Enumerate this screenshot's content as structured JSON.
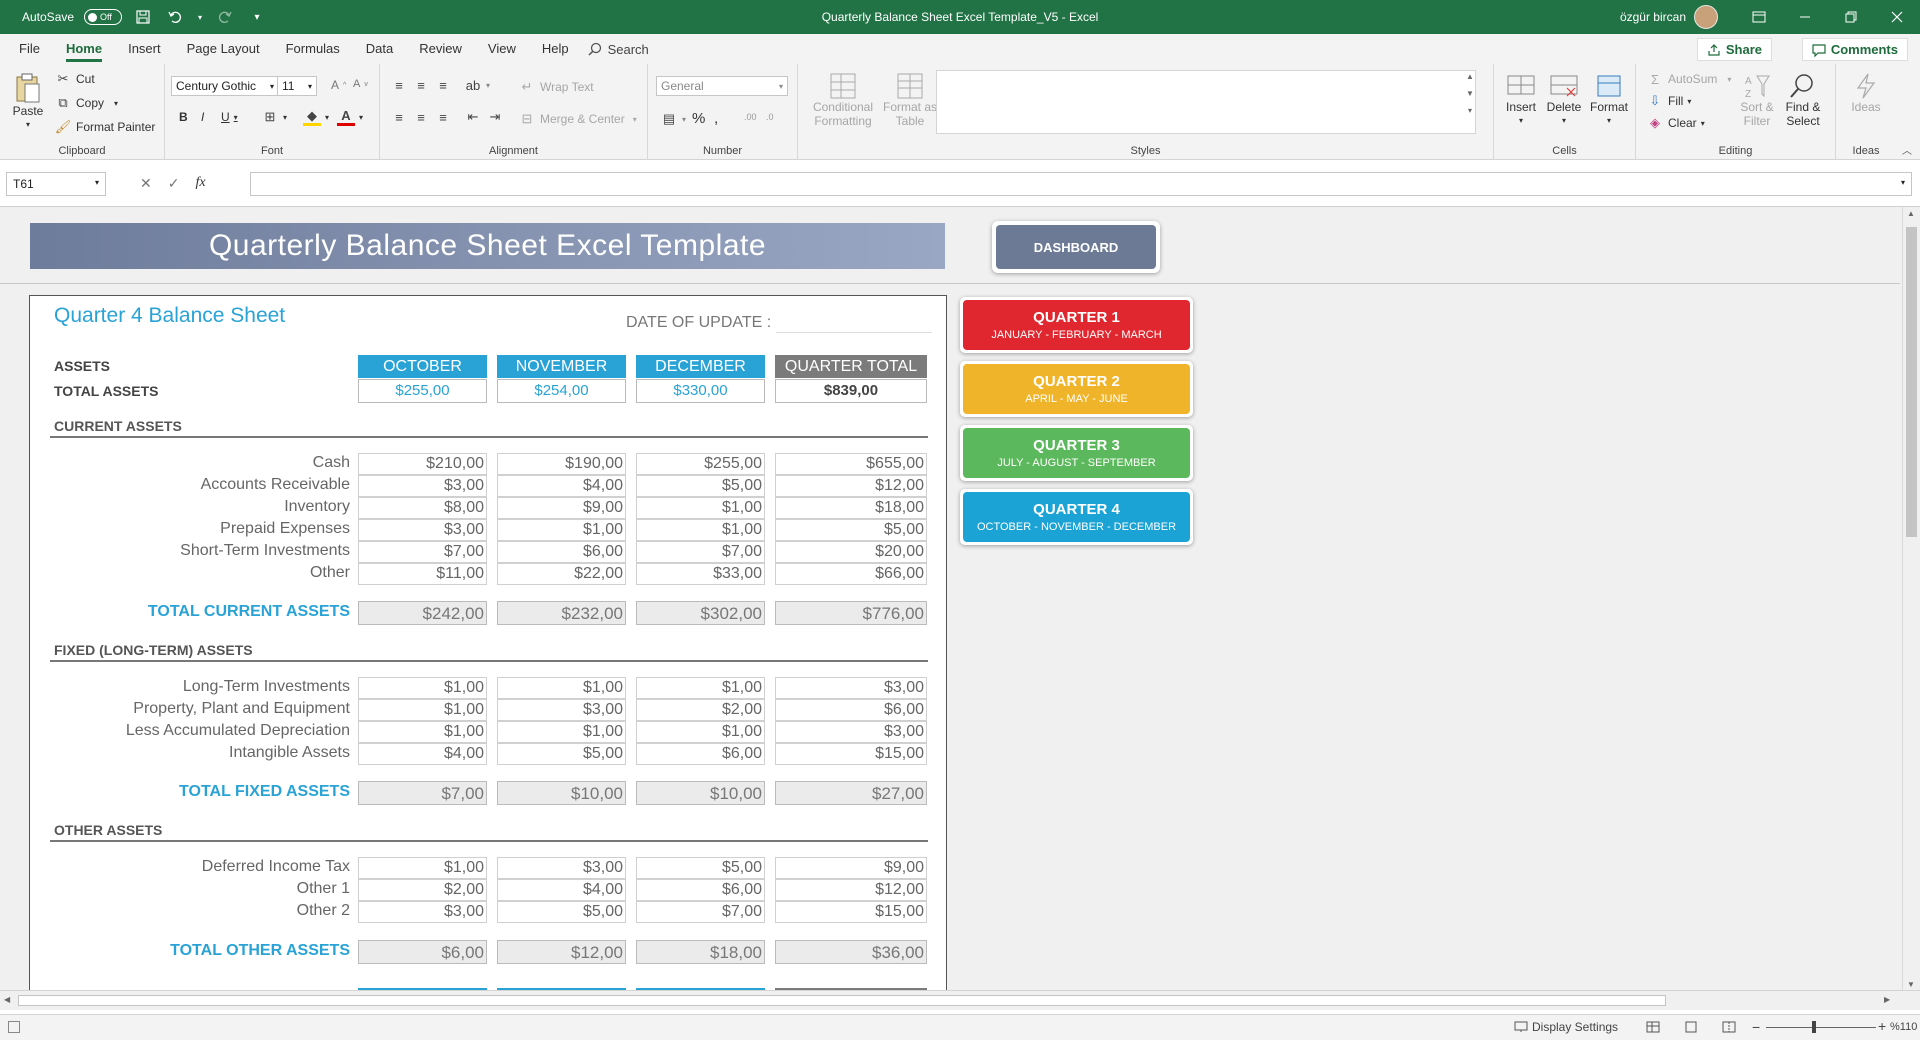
{
  "titlebar": {
    "autosave_label": "AutoSave",
    "autosave_state": "Off",
    "title": "Quarterly Balance Sheet Excel Template_V5  -  Excel",
    "user": "özgür bircan"
  },
  "tabs": [
    "File",
    "Home",
    "Insert",
    "Page Layout",
    "Formulas",
    "Data",
    "Review",
    "View",
    "Help"
  ],
  "active_tab": "Home",
  "search_label": "Search",
  "share_label": "Share",
  "comments_label": "Comments",
  "ribbon": {
    "clipboard": {
      "label": "Clipboard",
      "paste": "Paste",
      "cut": "Cut",
      "copy": "Copy",
      "format_painter": "Format Painter"
    },
    "font": {
      "label": "Font",
      "family": "Century Gothic",
      "size": "11"
    },
    "alignment": {
      "label": "Alignment",
      "wrap_text": "Wrap Text",
      "merge_center": "Merge & Center"
    },
    "number": {
      "label": "Number",
      "format": "General"
    },
    "styles": {
      "label": "Styles",
      "conditional": "Conditional Formatting",
      "format_table": "Format as Table"
    },
    "cells": {
      "label": "Cells",
      "insert": "Insert",
      "delete": "Delete",
      "format": "Format"
    },
    "editing": {
      "label": "Editing",
      "autosum": "AutoSum",
      "fill": "Fill",
      "clear": "Clear",
      "sort_filter": "Sort & Filter",
      "find_select": "Find & Select"
    },
    "ideas": {
      "label": "Ideas",
      "ideas_btn": "Ideas"
    }
  },
  "formula_bar": {
    "name_box": "T61",
    "fx": "fx",
    "value": ""
  },
  "sheet": {
    "banner_title": "Quarterly Balance Sheet Excel Template",
    "dashboard_label": "DASHBOARD",
    "quarters": [
      {
        "title": "QUARTER 1",
        "months": "JANUARY - FEBRUARY - MARCH",
        "color": "#e0262e"
      },
      {
        "title": "QUARTER 2",
        "months": "APRIL - MAY - JUNE",
        "color": "#f0b42a"
      },
      {
        "title": "QUARTER 3",
        "months": "JULY - AUGUST - SEPTEMBER",
        "color": "#5cb85c"
      },
      {
        "title": "QUARTER 4",
        "months": "OCTOBER - NOVEMBER - DECEMBER",
        "color": "#1aa3d4"
      }
    ],
    "panel_title": "Quarter 4 Balance Sheet",
    "date_label": "DATE OF UPDATE :",
    "assets_label": "ASSETS",
    "total_assets_label": "TOTAL ASSETS",
    "months": [
      "OCTOBER",
      "NOVEMBER",
      "DECEMBER",
      "QUARTER TOTAL"
    ],
    "total_assets": [
      "$255,00",
      "$254,00",
      "$330,00",
      "$839,00"
    ],
    "current": {
      "title": "CURRENT ASSETS",
      "rows": [
        {
          "label": "Cash",
          "values": [
            "$210,00",
            "$190,00",
            "$255,00",
            "$655,00"
          ]
        },
        {
          "label": "Accounts Receivable",
          "values": [
            "$3,00",
            "$4,00",
            "$5,00",
            "$12,00"
          ]
        },
        {
          "label": "Inventory",
          "values": [
            "$8,00",
            "$9,00",
            "$1,00",
            "$18,00"
          ]
        },
        {
          "label": "Prepaid Expenses",
          "values": [
            "$3,00",
            "$1,00",
            "$1,00",
            "$5,00"
          ]
        },
        {
          "label": "Short-Term Investments",
          "values": [
            "$7,00",
            "$6,00",
            "$7,00",
            "$20,00"
          ]
        },
        {
          "label": "Other",
          "values": [
            "$11,00",
            "$22,00",
            "$33,00",
            "$66,00"
          ]
        }
      ],
      "total_label": "TOTAL CURRENT ASSETS",
      "totals": [
        "$242,00",
        "$232,00",
        "$302,00",
        "$776,00"
      ]
    },
    "fixed": {
      "title": "FIXED (LONG-TERM) ASSETS",
      "rows": [
        {
          "label": "Long-Term Investments",
          "values": [
            "$1,00",
            "$1,00",
            "$1,00",
            "$3,00"
          ]
        },
        {
          "label": "Property, Plant and Equipment",
          "values": [
            "$1,00",
            "$3,00",
            "$2,00",
            "$6,00"
          ]
        },
        {
          "label": "Less Accumulated Depreciation",
          "values": [
            "$1,00",
            "$1,00",
            "$1,00",
            "$3,00"
          ]
        },
        {
          "label": "Intangible Assets",
          "values": [
            "$4,00",
            "$5,00",
            "$6,00",
            "$15,00"
          ]
        }
      ],
      "total_label": "TOTAL FIXED ASSETS",
      "totals": [
        "$7,00",
        "$10,00",
        "$10,00",
        "$27,00"
      ]
    },
    "other": {
      "title": "OTHER ASSETS",
      "rows": [
        {
          "label": "Deferred Income Tax",
          "values": [
            "$1,00",
            "$3,00",
            "$5,00",
            "$9,00"
          ]
        },
        {
          "label": "Other 1",
          "values": [
            "$2,00",
            "$4,00",
            "$6,00",
            "$12,00"
          ]
        },
        {
          "label": "Other 2",
          "values": [
            "$3,00",
            "$5,00",
            "$7,00",
            "$15,00"
          ]
        }
      ],
      "total_label": "TOTAL OTHER ASSETS",
      "totals": [
        "$6,00",
        "$12,00",
        "$18,00",
        "$36,00"
      ]
    }
  },
  "statusbar": {
    "display_settings": "Display Settings",
    "zoom": "%110"
  }
}
